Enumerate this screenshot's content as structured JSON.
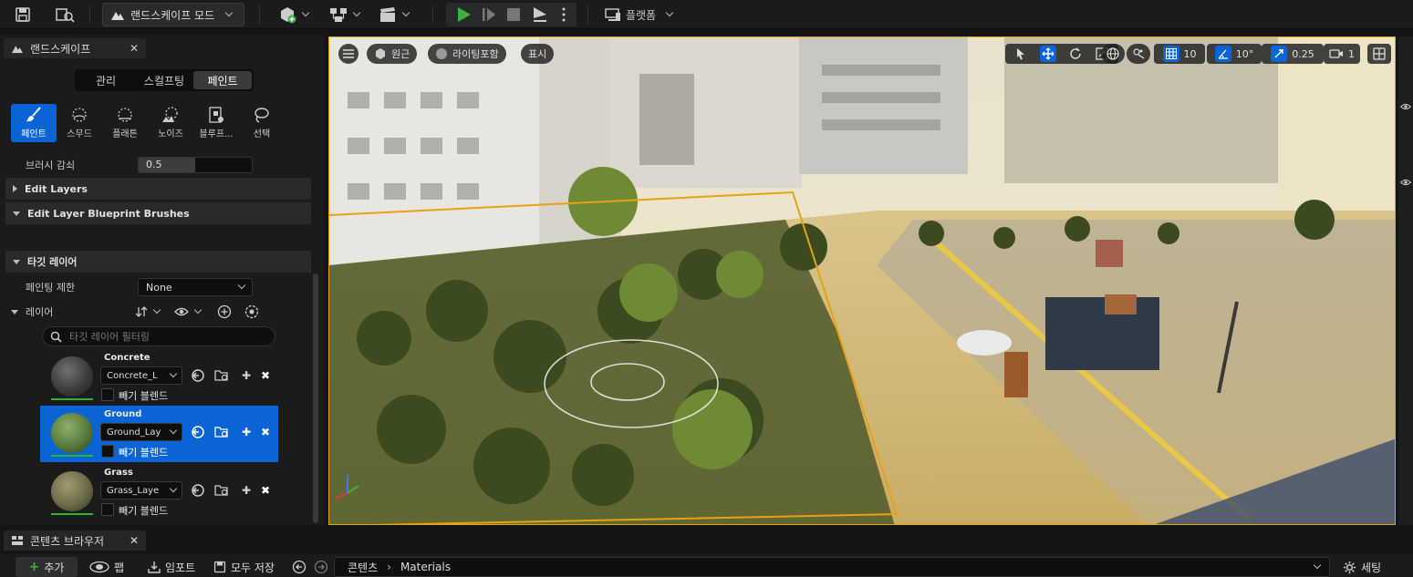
{
  "toolbar": {
    "mode_label": "랜드스케이프 모드",
    "platform_label": "플랫폼"
  },
  "panel": {
    "title": "랜드스케이프",
    "mode_tabs": [
      "관리",
      "스컬프팅",
      "페인트"
    ],
    "active_mode_tab": "페인트",
    "tools": [
      {
        "label": "페인트",
        "icon": "paintbrush-icon",
        "active": true
      },
      {
        "label": "스무드",
        "icon": "smooth-brush-icon",
        "active": false
      },
      {
        "label": "플래튼",
        "icon": "flatten-brush-icon",
        "active": false
      },
      {
        "label": "노이즈",
        "icon": "noise-icon",
        "active": false
      },
      {
        "label": "블루프...",
        "icon": "blueprint-brush-icon",
        "active": false
      },
      {
        "label": "선택",
        "icon": "select-lasso-icon",
        "active": false
      }
    ],
    "brush_falloff_label": "브러시 감쇠",
    "brush_falloff_value": "0.5",
    "edit_layers_label": "Edit Layers",
    "edit_layer_bp_label": "Edit Layer Blueprint Brushes",
    "target_layers_label": "타깃 레이어",
    "paint_restriction_label": "페인팅 제한",
    "paint_restriction_value": "None",
    "layers_label": "레이어",
    "layer_filter_placeholder": "타깃 레이어 필터링",
    "layers": [
      {
        "name": "Concrete",
        "asset": "Concrete_L",
        "option": "빼기 블렌드",
        "selected": false
      },
      {
        "name": "Ground",
        "asset": "Ground_Lay",
        "option": "빼기 블렌드",
        "selected": true
      },
      {
        "name": "Grass",
        "asset": "Grass_Laye",
        "option": "빼기 블렌드",
        "selected": false
      }
    ]
  },
  "viewport": {
    "perspective_label": "원근",
    "lighting_label": "라이팅포함",
    "show_label": "표시",
    "grid_snap_value": "10",
    "rotation_snap_value": "10°",
    "scale_snap_value": "0.25",
    "camera_speed_value": "1"
  },
  "content_browser": {
    "tab_title": "콘텐츠 브라우저",
    "add_label": "추가",
    "import_label": "임포트",
    "save_all_label": "모두 저장",
    "fab_label": "팹",
    "path_root": "콘텐츠",
    "path_leaf": "Materials",
    "settings_label": "세팅"
  },
  "colors": {
    "accent": "#0a64d6",
    "selection_outline": "#e6a214",
    "play_green": "#3cb043",
    "layer_weight_bar": "#2db52d"
  }
}
